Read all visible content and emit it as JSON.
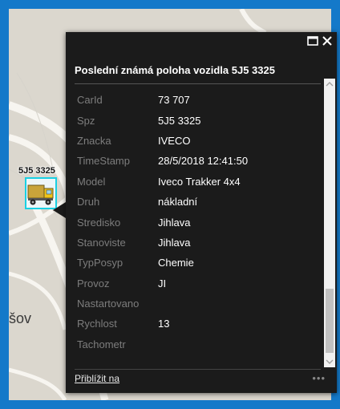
{
  "map": {
    "place_label": "šov",
    "vehicle_label": "5J5 3325"
  },
  "popup": {
    "title": "Poslední známá poloha vozidla 5J5 3325",
    "attributes": [
      {
        "key": "CarId",
        "value": "73 707"
      },
      {
        "key": "Spz",
        "value": "5J5 3325"
      },
      {
        "key": "Znacka",
        "value": "IVECO"
      },
      {
        "key": "TimeStamp",
        "value": "28/5/2018 12:41:50"
      },
      {
        "key": "Model",
        "value": "Iveco Trakker 4x4"
      },
      {
        "key": "Druh",
        "value": "nákladní"
      },
      {
        "key": "Stredisko",
        "value": "Jihlava"
      },
      {
        "key": "Stanoviste",
        "value": "Jihlava"
      },
      {
        "key": "TypPosyp",
        "value": "Chemie"
      },
      {
        "key": "Provoz",
        "value": "JI"
      },
      {
        "key": "Nastartovano",
        "value": ""
      },
      {
        "key": "Rychlost",
        "value": "13"
      },
      {
        "key": "Tachometr",
        "value": ""
      }
    ],
    "zoom_link": "Přiblížit na",
    "more_icon": "•••"
  },
  "colors": {
    "frame": "#1479c9",
    "popup_bg": "#1b1b1b",
    "marker_border": "#19d0e3"
  }
}
